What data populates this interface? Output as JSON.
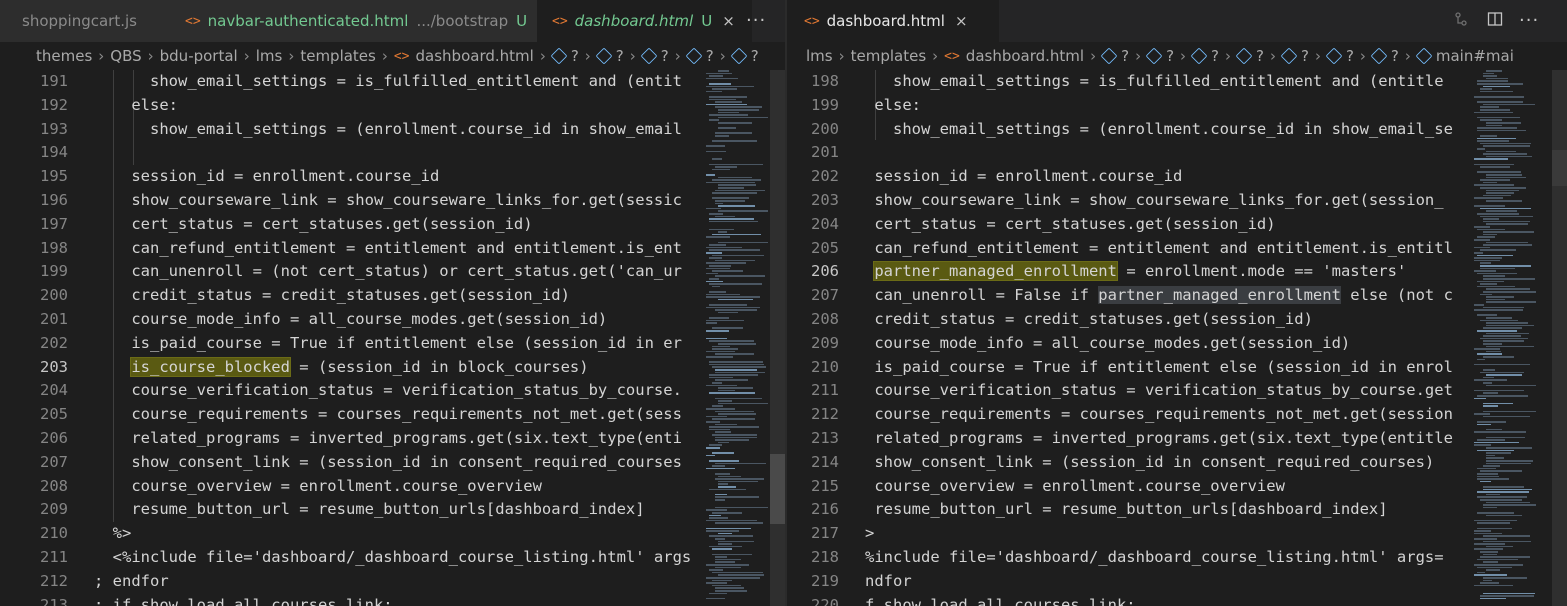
{
  "left_pane": {
    "tabs": [
      {
        "label": "shoppingcart.js",
        "status": "",
        "active": false
      },
      {
        "label": "navbar-authenticated.html",
        "detail": ".../bootstrap",
        "status": "U",
        "active": false
      },
      {
        "label": "dashboard.html",
        "status": "U",
        "active": true
      }
    ],
    "more_label": "···",
    "breadcrumb": [
      "themes",
      "QBS",
      "bdu-portal",
      "lms",
      "templates",
      "dashboard.html",
      "?",
      "?",
      "?",
      "?",
      "?"
    ],
    "lines": [
      {
        "n": "191",
        "text": "      show_email_settings = is_fulfilled_entitlement and (entit"
      },
      {
        "n": "192",
        "text": "    else:"
      },
      {
        "n": "193",
        "text": "      show_email_settings = (enrollment.course_id in show_email"
      },
      {
        "n": "194",
        "text": ""
      },
      {
        "n": "195",
        "text": "    session_id = enrollment.course_id"
      },
      {
        "n": "196",
        "text": "    show_courseware_link = show_courseware_links_for.get(sessic"
      },
      {
        "n": "197",
        "text": "    cert_status = cert_statuses.get(session_id)"
      },
      {
        "n": "198",
        "text": "    can_refund_entitlement = entitlement and entitlement.is_ent"
      },
      {
        "n": "199",
        "text": "    can_unenroll = (not cert_status) or cert_status.get('can_ur"
      },
      {
        "n": "200",
        "text": "    credit_status = credit_statuses.get(session_id)"
      },
      {
        "n": "201",
        "text": "    course_mode_info = all_course_modes.get(session_id)"
      },
      {
        "n": "202",
        "text": "    is_paid_course = True if entitlement else (session_id in er"
      },
      {
        "n": "203",
        "pre": "    ",
        "hl": "is_course_blocked",
        "post": " = (session_id in block_courses)",
        "current": true
      },
      {
        "n": "204",
        "text": "    course_verification_status = verification_status_by_course."
      },
      {
        "n": "205",
        "text": "    course_requirements = courses_requirements_not_met.get(sess"
      },
      {
        "n": "206",
        "text": "    related_programs = inverted_programs.get(six.text_type(enti"
      },
      {
        "n": "207",
        "text": "    show_consent_link = (session_id in consent_required_courses"
      },
      {
        "n": "208",
        "text": "    course_overview = enrollment.course_overview"
      },
      {
        "n": "209",
        "text": "    resume_button_url = resume_button_urls[dashboard_index]"
      },
      {
        "n": "210",
        "text": "  %>"
      },
      {
        "n": "211",
        "text": "  <%include file='dashboard/_dashboard_course_listing.html' args"
      },
      {
        "n": "212",
        "text": "; endfor"
      },
      {
        "n": "213",
        "text": "; if show_load_all_courses_link:"
      }
    ]
  },
  "right_pane": {
    "tabs": [
      {
        "label": "dashboard.html",
        "status": "",
        "active": true
      }
    ],
    "more_label": "···",
    "breadcrumb": [
      "lms",
      "templates",
      "dashboard.html",
      "?",
      "?",
      "?",
      "?",
      "?",
      "?",
      "?",
      "main#mai"
    ],
    "lines": [
      {
        "n": "198",
        "text": "   show_email_settings = is_fulfilled_entitlement and (entitle"
      },
      {
        "n": "199",
        "text": " else:"
      },
      {
        "n": "200",
        "text": "   show_email_settings = (enrollment.course_id in show_email_se"
      },
      {
        "n": "201",
        "text": ""
      },
      {
        "n": "202",
        "text": " session_id = enrollment.course_id"
      },
      {
        "n": "203",
        "text": " show_courseware_link = show_courseware_links_for.get(session_"
      },
      {
        "n": "204",
        "text": " cert_status = cert_statuses.get(session_id)"
      },
      {
        "n": "205",
        "text": " can_refund_entitlement = entitlement and entitlement.is_entitl"
      },
      {
        "n": "206",
        "pre": " ",
        "hl": "partner_managed_enrollment",
        "post": " = enrollment.mode == 'masters'",
        "current": true
      },
      {
        "n": "207",
        "pre": " can_unenroll = False if ",
        "word": "partner_managed_enrollment",
        "post": " else (not c"
      },
      {
        "n": "208",
        "text": " credit_status = credit_statuses.get(session_id)"
      },
      {
        "n": "209",
        "text": " course_mode_info = all_course_modes.get(session_id)"
      },
      {
        "n": "210",
        "text": " is_paid_course = True if entitlement else (session_id in enrol"
      },
      {
        "n": "211",
        "text": " course_verification_status = verification_status_by_course.get"
      },
      {
        "n": "212",
        "text": " course_requirements = courses_requirements_not_met.get(session"
      },
      {
        "n": "213",
        "text": " related_programs = inverted_programs.get(six.text_type(entitle"
      },
      {
        "n": "214",
        "text": " show_consent_link = (session_id in consent_required_courses)"
      },
      {
        "n": "215",
        "text": " course_overview = enrollment.course_overview"
      },
      {
        "n": "216",
        "text": " resume_button_url = resume_button_urls[dashboard_index]"
      },
      {
        "n": "217",
        "text": ">"
      },
      {
        "n": "218",
        "text": "%include file='dashboard/_dashboard_course_listing.html' args="
      },
      {
        "n": "219",
        "text": "ndfor"
      },
      {
        "n": "220",
        "text": "f show_load_all_courses_link:"
      }
    ]
  },
  "colors": {
    "editor_bg": "#1e1e1e",
    "tabbar_bg": "#252526",
    "untracked": "#73c991",
    "html_icon": "#e37933",
    "highlight": "#5a5a12"
  },
  "icons": {
    "html_file": "<>",
    "close": "×",
    "chevron": "›",
    "symbol": "cube-icon"
  }
}
